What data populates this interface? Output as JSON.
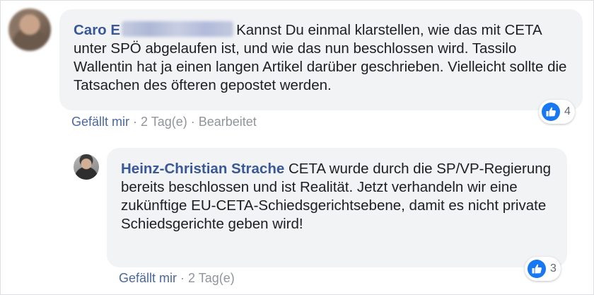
{
  "comments": [
    {
      "author_visible": "Caro E",
      "text": "Kannst Du einmal klarstellen, wie das mit CETA unter SPÖ abgelaufen ist, und wie das nun beschlossen wird. Tassilo Wallentin hat ja einen langen Artikel darüber geschrieben. Vielleicht sollte die Tatsachen des öfteren gepostet werden.",
      "like_label": "Gefällt mir",
      "time": "2 Tag(e)",
      "edited": "Bearbeitet",
      "reaction_icon": "like-icon",
      "reaction_count": "4"
    },
    {
      "author": "Heinz-Christian Strache",
      "text": "CETA wurde durch die SP/VP-Regierung bereits beschlossen und ist Realität. Jetzt verhandeln wir eine zukünftige EU-CETA-Schiedsgerichtsebene, damit es nicht private Schiedsgerichte geben wird!",
      "like_label": "Gefällt mir",
      "time": "2 Tag(e)",
      "reaction_icon": "like-icon",
      "reaction_count": "3"
    }
  ],
  "separator": "·",
  "colors": {
    "bubble_bg": "#f2f3f5",
    "author_link": "#385898",
    "action_link": "#4b67a1",
    "meta_text": "#90949c",
    "like_blue": "#1877f2"
  }
}
